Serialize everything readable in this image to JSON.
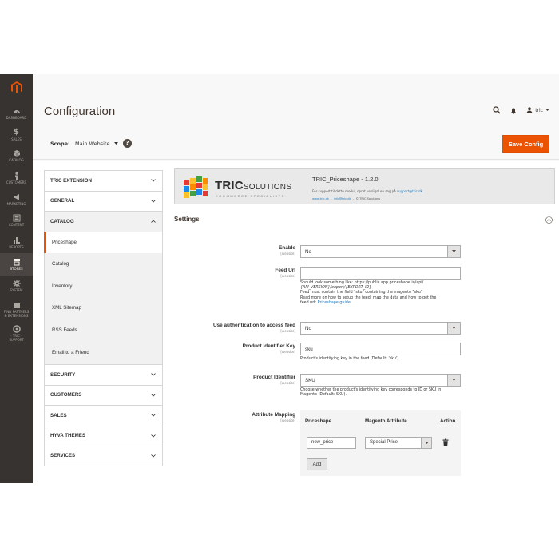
{
  "nav": {
    "items": [
      {
        "label": "DASHBOARD"
      },
      {
        "label": "SALES"
      },
      {
        "label": "CATALOG"
      },
      {
        "label": "CUSTOMERS"
      },
      {
        "label": "MARKETING"
      },
      {
        "label": "CONTENT"
      },
      {
        "label": "REPORTS"
      },
      {
        "label": "STORES"
      },
      {
        "label": "SYSTEM"
      },
      {
        "label_line1": "FIND PARTNERS",
        "label_line2": "& EXTENSIONS"
      },
      {
        "label_line1": "- TRIC -",
        "label_line2": "SUPPORT"
      }
    ]
  },
  "header": {
    "title": "Configuration",
    "user": "tric"
  },
  "scope": {
    "label": "Scope:",
    "value": "Main Website",
    "help": "?",
    "save_label": "Save Config"
  },
  "tabs": {
    "tric_extension": "TRIC EXTENSION",
    "general": "GENERAL",
    "catalog": "CATALOG",
    "sub": [
      "Priceshape",
      "Catalog",
      "Inventory",
      "XML Sitemap",
      "RSS Feeds",
      "Email to a Friend"
    ],
    "security": "SECURITY",
    "customers": "CUSTOMERS",
    "sales": "SALES",
    "hyva": "HYVA THEMES",
    "services": "SERVICES"
  },
  "banner": {
    "brand_main": "TRIC",
    "brand_sol": "SOLUTIONS",
    "tagline": "ECOMMERCE SPECIALISTS",
    "title": "TRIC_Priceshape - 1.2.0",
    "support_text": "For support til dette modul, opret venligst en sag på",
    "support_email": "support@tric.dk.",
    "link_site": "www.tric.dk",
    "link_info": "info@tric.dk",
    "copyright": "© TRIC Solutions"
  },
  "settings": {
    "title": "Settings",
    "website_hint": "[website]",
    "enable": {
      "label": "Enable",
      "value": "No"
    },
    "feed_url": {
      "label": "Feed Url",
      "value": "",
      "note1": "Should look something like: https://public.app.priceshape.io/api/",
      "note2": "{API_VERSION}/export/{EXPORT_ID}",
      "note3": "Feed must contain the field \"sku\" containing the magento \"sku\"",
      "note4": "Read more on how to setup the feed, map the data and how to get the",
      "note5": "feed url:",
      "note_link": "Priceshape guide"
    },
    "auth": {
      "label": "Use authentication to access feed",
      "value": "No"
    },
    "identifier_key": {
      "label": "Product Identifier Key",
      "value": "sku",
      "note": "Product's identifying key in the feed (Default: 'sku')."
    },
    "identifier": {
      "label": "Product Identifier",
      "value": "SKU",
      "note1": "Choose whether the product's identifying key corresponds to ID or SKU in",
      "note2": "Magento (Default: SKU)."
    },
    "mapping": {
      "label": "Attribute Mapping",
      "col_priceshape": "Priceshape",
      "col_magento": "Magento Attribute",
      "col_action": "Action",
      "row_priceshape": "new_price",
      "row_magento": "Special Price",
      "add_label": "Add"
    }
  }
}
